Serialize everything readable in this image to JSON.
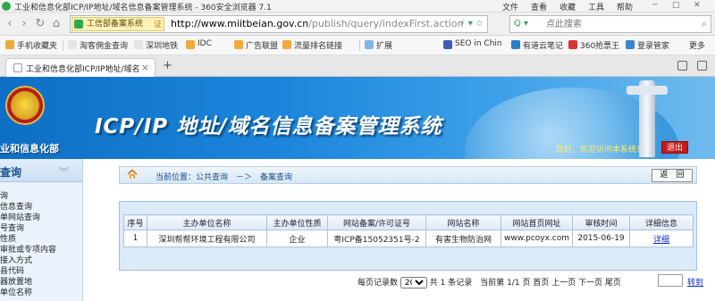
{
  "window": {
    "title": "工业和信息化部ICP/IP地址/域名信息备案管理系统 - 360安全浏览器 7.1",
    "menu": [
      "文件",
      "查看",
      "收藏",
      "工具",
      "帮助"
    ]
  },
  "address_bar": {
    "verified_badge": "工信部备案系统",
    "cert_label": "证",
    "url_host": "http://www.miitbeian.gov.cn",
    "url_path": "/publish/query/indexFirst.action",
    "search_placeholder": "点此搜索"
  },
  "bookmarks": [
    {
      "label": "手机收藏夹",
      "color": "#f2a93b"
    },
    {
      "label": "淘客佣金查询",
      "color": "#e5e5e5"
    },
    {
      "label": "深圳地铁",
      "color": "#e5e5e5"
    },
    {
      "label": "IDC",
      "color": "#f2a93b"
    },
    {
      "label": "广告联盟",
      "color": "#f2a93b"
    },
    {
      "label": "流量排名链接",
      "color": "#f2a93b"
    },
    {
      "label": "扩展",
      "color": "#7fb6e6"
    },
    {
      "label": "SEO in Chin",
      "color": "#3b5db8"
    },
    {
      "label": "有道云笔记",
      "color": "#2a7ec7"
    },
    {
      "label": "360抢票王",
      "color": "#d83434"
    },
    {
      "label": "登录管家",
      "color": "#3b86d1"
    },
    {
      "label": "更多",
      "color": "#f7f7f7"
    }
  ],
  "tab": {
    "title": "工业和信息化部ICP/IP地址/域名",
    "close": "×",
    "new_tab": "+"
  },
  "header": {
    "ministry": "业和信息化部",
    "system_title": "ICP/IP 地址/域名信息备案管理系统",
    "welcome": "您好，欢迎访问本系统！",
    "logout": "退出"
  },
  "sidebar": {
    "title": "查询",
    "items": [
      "询",
      "信息查询",
      "单网站查询",
      "号查询",
      "性质",
      "审批或专项内容",
      "接入方式",
      "县代码",
      "器放置地",
      "单位名称"
    ]
  },
  "breadcrumb": {
    "text": "当前位置：公共查询　－＞　备案查询",
    "back": "返　回"
  },
  "results": {
    "columns": [
      "序号",
      "主办单位名称",
      "主办单位性质",
      "网站备案/许可证号",
      "网站名称",
      "网站首页网址",
      "审核时间",
      "详细信息"
    ],
    "rows": [
      {
        "index": "1",
        "org_name": "深圳帮帮环境工程有限公司",
        "org_type": "企业",
        "license": "粤ICP备15052351号-2",
        "site_name": "有害生物防治网",
        "site_url": "www.pcoyx.com",
        "audit_date": "2015-06-19",
        "detail": "详细"
      }
    ]
  },
  "pager": {
    "per_page_label": "每页记录数",
    "per_page_value": "20",
    "summary": "共 1 条记录　当前第 1/1 页 首页 上一页 下一页 尾页",
    "goto": "转到"
  }
}
